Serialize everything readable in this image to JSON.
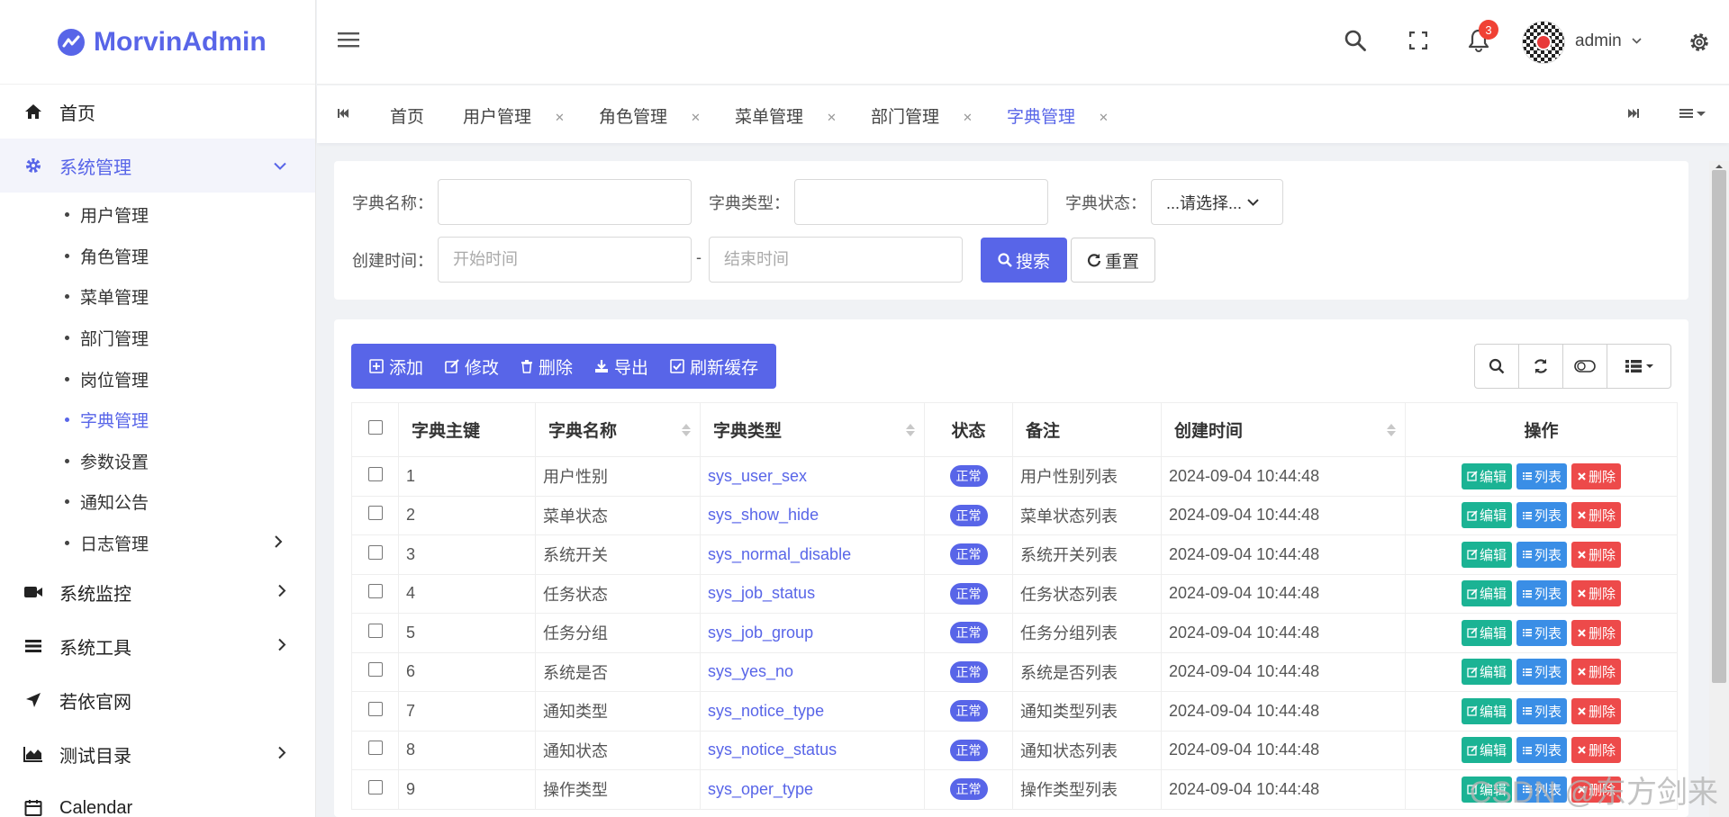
{
  "app": {
    "name": "MorvinAdmin",
    "brand_color": "#5865e8"
  },
  "sidebar": {
    "items": [
      {
        "label": "首页",
        "icon": "home-icon"
      },
      {
        "label": "系统管理",
        "icon": "gear-icon",
        "expanded": true
      },
      {
        "label": "系统监控",
        "icon": "video-icon"
      },
      {
        "label": "系统工具",
        "icon": "bars-icon"
      },
      {
        "label": "若依官网",
        "icon": "send-icon"
      },
      {
        "label": "测试目录",
        "icon": "area-chart-icon"
      },
      {
        "label": "Calendar",
        "icon": "calendar-icon"
      }
    ],
    "sub_items": [
      "用户管理",
      "角色管理",
      "菜单管理",
      "部门管理",
      "岗位管理",
      "字典管理",
      "参数设置",
      "通知公告",
      "日志管理"
    ],
    "active_sub": "字典管理"
  },
  "header": {
    "notification_count": "3",
    "user": "admin"
  },
  "tabs": [
    "首页",
    "用户管理",
    "角色管理",
    "菜单管理",
    "部门管理",
    "字典管理"
  ],
  "active_tab": "字典管理",
  "search": {
    "dict_name_label": "字典名称：",
    "dict_type_label": "字典类型：",
    "status_label": "字典状态：",
    "status_value": "...请选择...",
    "time_label": "创建时间：",
    "start_placeholder": "开始时间",
    "end_placeholder": "结束时间",
    "range_sep": "-",
    "search_btn": "搜索",
    "reset_btn": "重置"
  },
  "toolbar": {
    "add": "添加",
    "edit": "修改",
    "delete": "删除",
    "export": "导出",
    "refresh_cache": "刷新缓存"
  },
  "table": {
    "headers": [
      "字典主键",
      "字典名称",
      "字典类型",
      "状态",
      "备注",
      "创建时间",
      "操作"
    ],
    "rows": [
      [
        "1",
        "用户性别",
        "sys_user_sex",
        "正常",
        "用户性别列表",
        "2024-09-04 10:44:48"
      ],
      [
        "2",
        "菜单状态",
        "sys_show_hide",
        "正常",
        "菜单状态列表",
        "2024-09-04 10:44:48"
      ],
      [
        "3",
        "系统开关",
        "sys_normal_disable",
        "正常",
        "系统开关列表",
        "2024-09-04 10:44:48"
      ],
      [
        "4",
        "任务状态",
        "sys_job_status",
        "正常",
        "任务状态列表",
        "2024-09-04 10:44:48"
      ],
      [
        "5",
        "任务分组",
        "sys_job_group",
        "正常",
        "任务分组列表",
        "2024-09-04 10:44:48"
      ],
      [
        "6",
        "系统是否",
        "sys_yes_no",
        "正常",
        "系统是否列表",
        "2024-09-04 10:44:48"
      ],
      [
        "7",
        "通知类型",
        "sys_notice_type",
        "正常",
        "通知类型列表",
        "2024-09-04 10:44:48"
      ],
      [
        "8",
        "通知状态",
        "sys_notice_status",
        "正常",
        "通知状态列表",
        "2024-09-04 10:44:48"
      ],
      [
        "9",
        "操作类型",
        "sys_oper_type",
        "正常",
        "操作类型列表",
        "2024-09-04 10:44:48"
      ]
    ],
    "row_actions": {
      "edit": "编辑",
      "list": "列表",
      "delete": "删除"
    }
  },
  "watermark": "CSDN @东方剑来"
}
